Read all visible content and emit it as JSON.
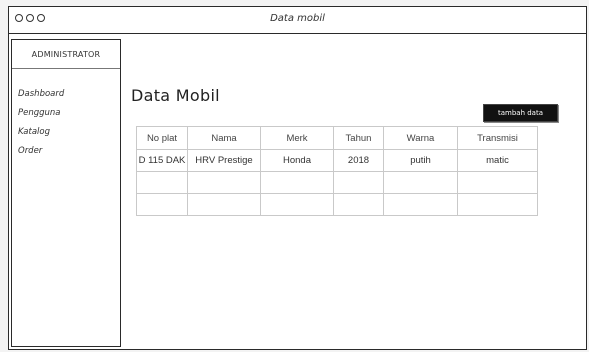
{
  "window": {
    "title": "Data mobil"
  },
  "sidebar": {
    "header": "ADMINISTRATOR",
    "items": [
      {
        "label": "Dashboard"
      },
      {
        "label": "Pengguna"
      },
      {
        "label": "Katalog"
      },
      {
        "label": "Order"
      }
    ]
  },
  "main": {
    "title": "Data Mobil",
    "add_button": "tambah data"
  },
  "table": {
    "columns": [
      "No plat",
      "Nama",
      "Merk",
      "Tahun",
      "Warna",
      "Transmisi"
    ],
    "rows": [
      [
        "D 115 DAK",
        "HRV Prestige",
        "Honda",
        "2018",
        "putih",
        "matic"
      ],
      [
        "",
        "",
        "",
        "",
        "",
        ""
      ],
      [
        "",
        "",
        "",
        "",
        "",
        ""
      ]
    ]
  }
}
